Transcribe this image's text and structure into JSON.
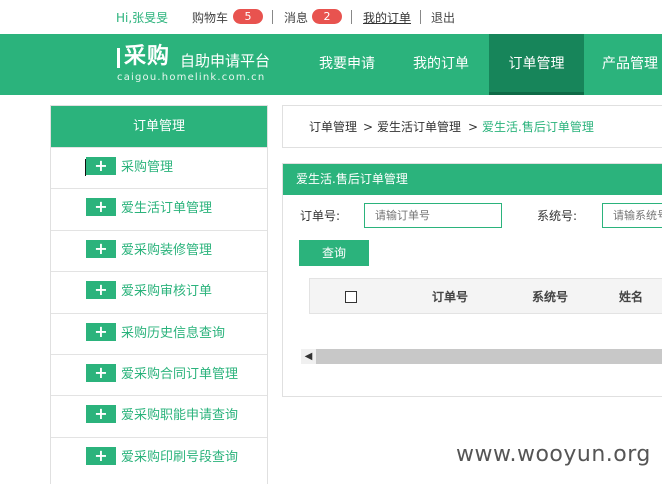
{
  "topbar": {
    "greeting": "Hi,张旻旻",
    "cart_label": "购物车",
    "cart_count": "5",
    "message_label": "消息",
    "message_count": "2",
    "my_orders": "我的订单",
    "logout": "退出"
  },
  "header": {
    "logo_main": "采购",
    "logo_sub": "自助申请平台",
    "logo_domain": "caigou.homelink.com.cn",
    "nav": [
      "我要申请",
      "我的订单",
      "订单管理",
      "产品管理"
    ],
    "active_nav": "订单管理"
  },
  "sidebar": {
    "title": "订单管理",
    "items": [
      {
        "icon": "plus-icon",
        "label": "采购管理"
      },
      {
        "icon": "plus-icon",
        "label": "爱生活订单管理"
      },
      {
        "icon": "plus-icon",
        "label": "爱采购装修管理"
      },
      {
        "icon": "plus-icon",
        "label": "爱采购审核订单"
      },
      {
        "icon": "plus-icon",
        "label": "采购历史信息查询"
      },
      {
        "icon": "plus-icon",
        "label": "爱采购合同订单管理"
      },
      {
        "icon": "plus-icon",
        "label": "爱采购职能申请查询"
      },
      {
        "icon": "plus-icon",
        "label": "爱采购印刷号段查询"
      }
    ]
  },
  "breadcrumb": {
    "items": [
      "订单管理",
      "爱生活订单管理",
      "爱生活.售后订单管理"
    ],
    "separator": ">"
  },
  "panel": {
    "title": "爱生活.售后订单管理",
    "order_label": "订单号:",
    "order_placeholder": "请输订单号",
    "system_label": "系统号:",
    "system_placeholder": "请输系统号",
    "query_button": "查询",
    "columns": [
      "订单号",
      "系统号",
      "姓名"
    ]
  },
  "watermark": "www.wooyun.org",
  "colors": {
    "accent": "#2bb37c",
    "accent_dark": "#17855a",
    "badge": "#e8534f"
  }
}
